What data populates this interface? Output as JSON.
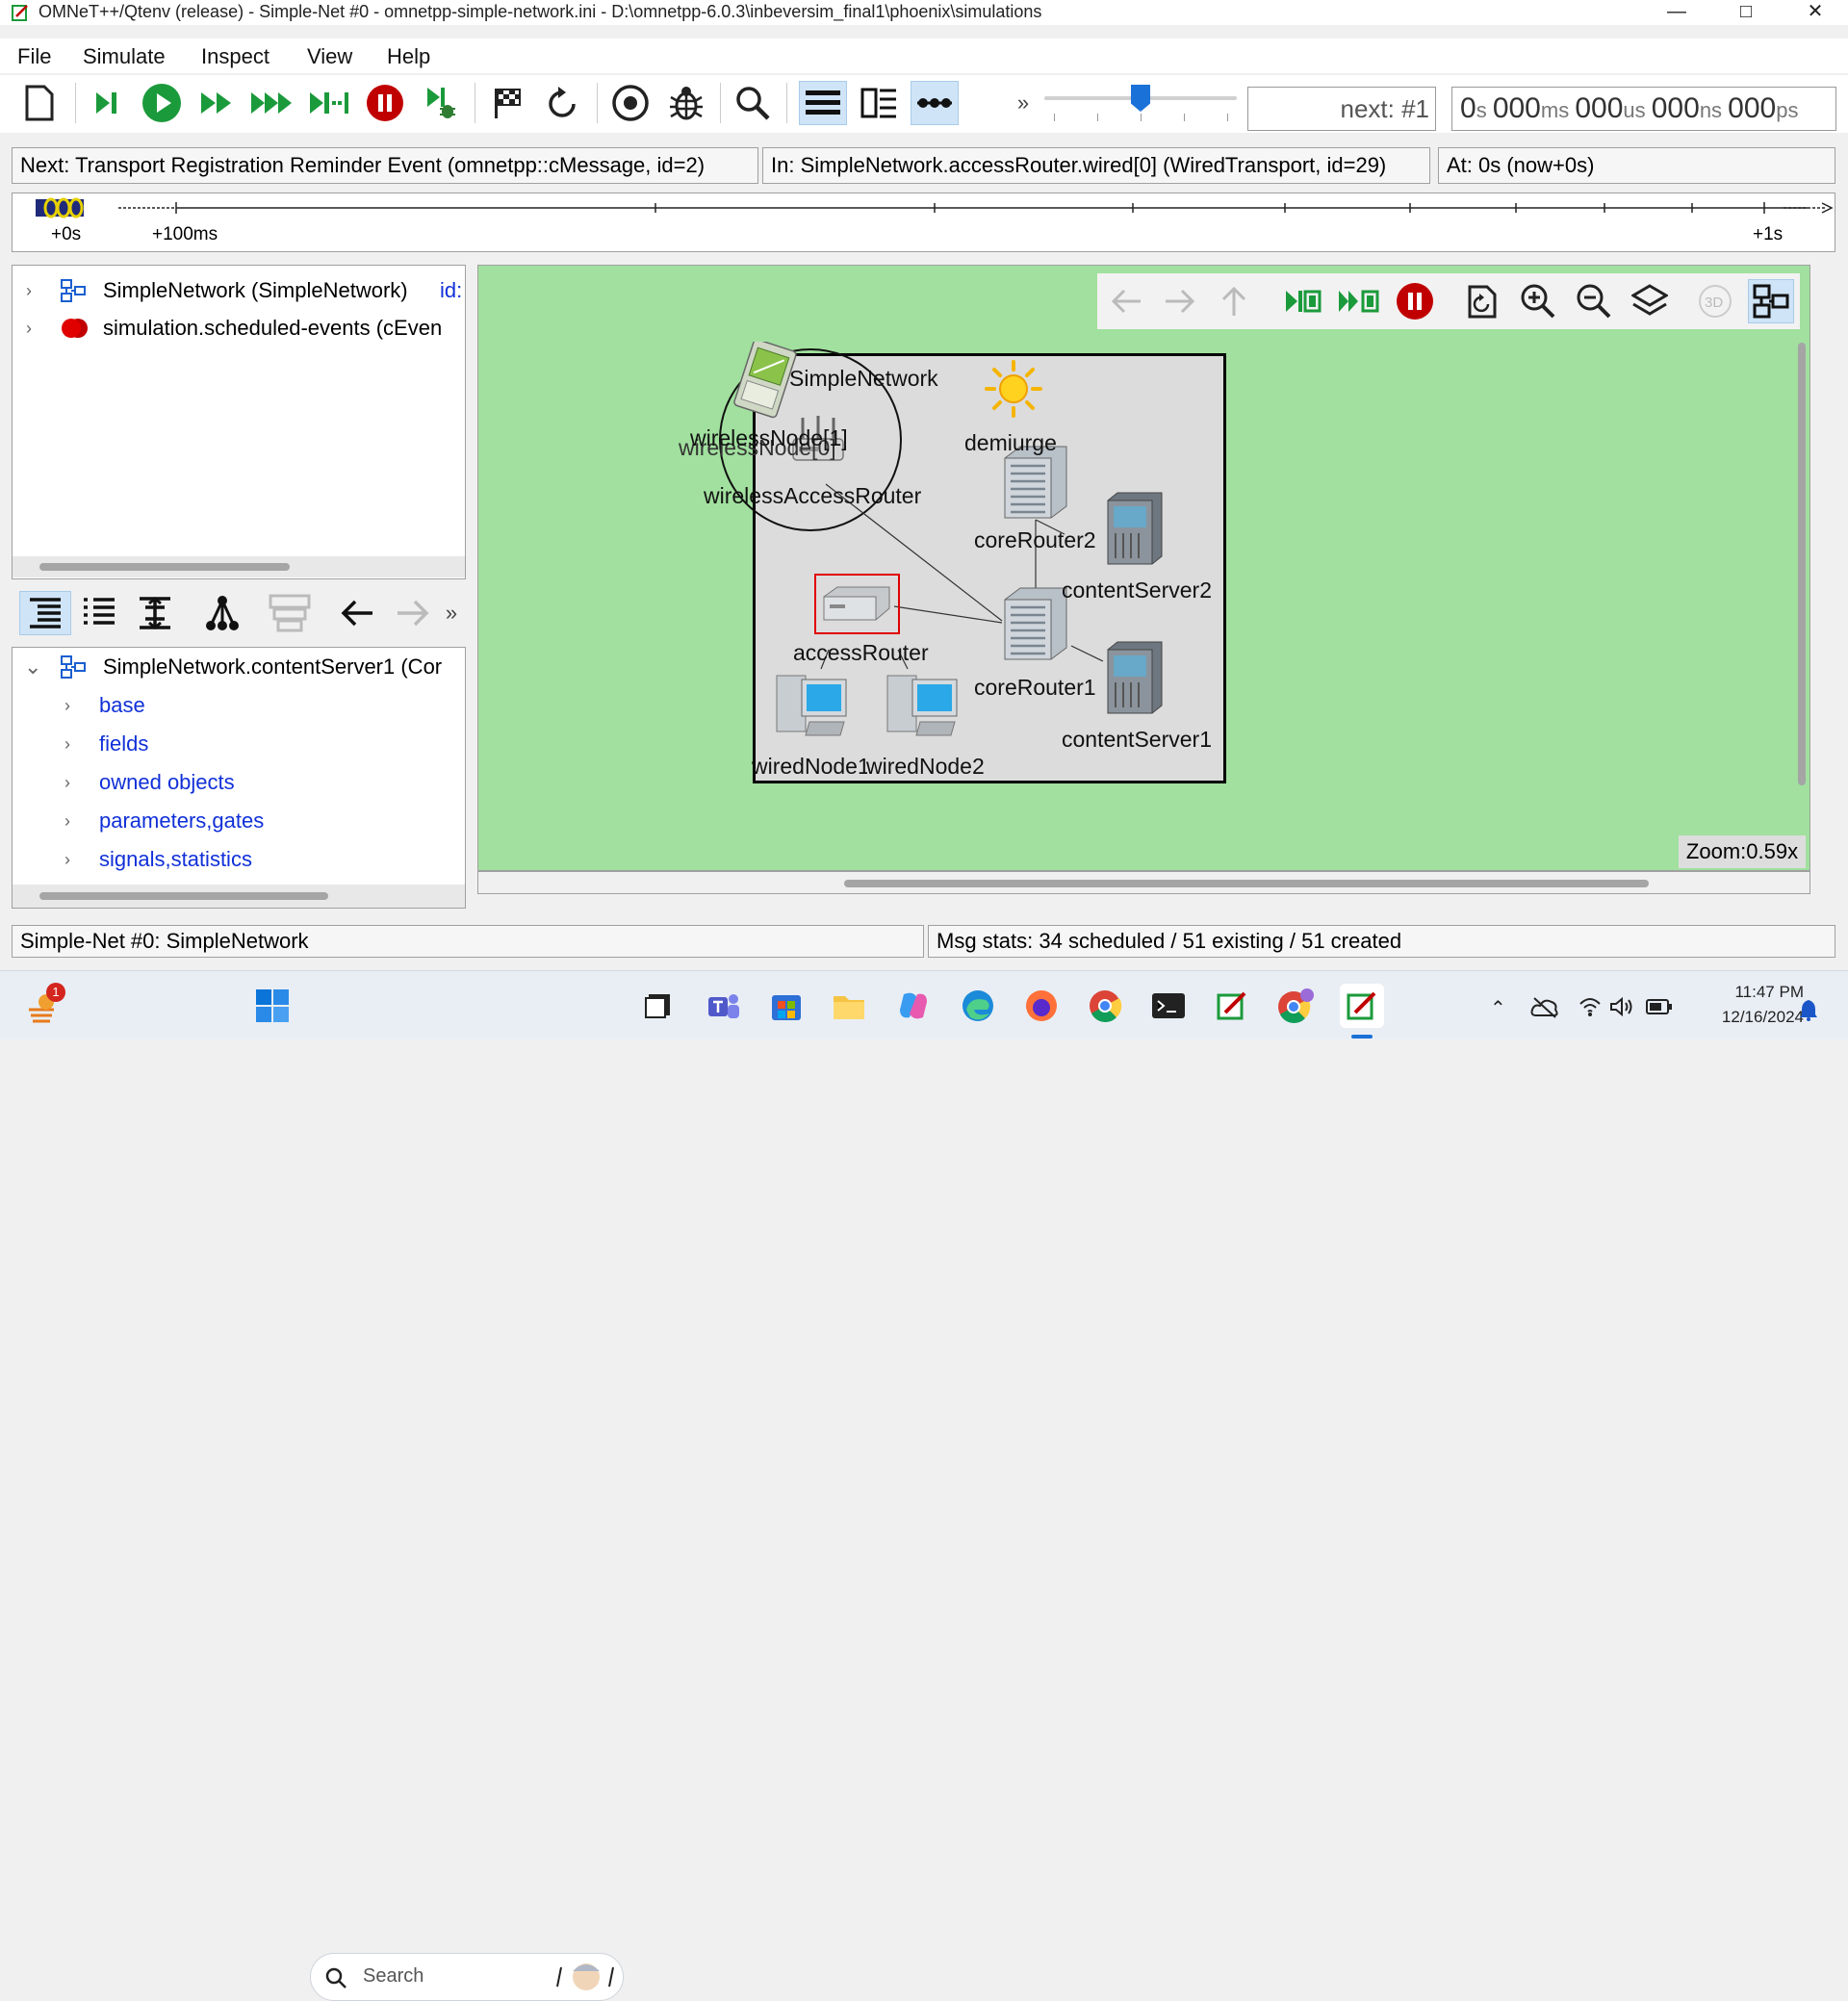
{
  "window": {
    "title": "OMNeT++/Qtenv (release) - Simple-Net #0 - omnetpp-simple-network.ini - D:\\omnetpp-6.0.3\\inbeversim_final1\\phoenix\\simulations",
    "controls": [
      "minimize",
      "maximize",
      "close"
    ]
  },
  "menu": [
    "File",
    "Simulate",
    "Inspect",
    "View",
    "Help"
  ],
  "toolbar": {
    "buttons": [
      "new-file-icon",
      "step-icon",
      "run-icon",
      "fast-run-icon",
      "express-run-icon",
      "run-until-icon",
      "stop-icon",
      "debug-next-icon",
      "finish-icon",
      "rebuild-icon",
      "record-icon",
      "debug-icon",
      "find-icon",
      "timeline-toggle-icon",
      "split-view-icon",
      "animation-icon"
    ],
    "overflow": "»",
    "next_event": "next: #1",
    "sim_time": {
      "s": "0",
      "ms": "000",
      "us": "000",
      "ns": "000",
      "ps": "000"
    }
  },
  "info": {
    "next": "Next: Transport Registration Reminder Event (omnetpp::cMessage, id=2)",
    "in": "In: SimpleNetwork.accessRouter.wired[0] (WiredTransport, id=29)",
    "at": "At: 0s (now+0s)"
  },
  "timeline": {
    "labels": [
      "+0s",
      "+100ms",
      "+1s"
    ]
  },
  "object_tree": {
    "items": [
      {
        "label": "SimpleNetwork (SimpleNetwork)",
        "suffix": "id:"
      },
      {
        "label": "simulation.scheduled-events (cEven"
      }
    ]
  },
  "inspector_toolbar": {
    "overflow": "»"
  },
  "inspector": {
    "root": "SimpleNetwork.contentServer1 (Cor",
    "children": [
      "base",
      "fields",
      "owned objects",
      "parameters,gates",
      "signals,statistics"
    ]
  },
  "network": {
    "title": "SimpleNetwork",
    "nodes": {
      "wirelessNode1": "wirelessNode[1]",
      "wirelessNode0": "wirelessNode[0]",
      "wirelessAccessRouter": "wirelessAccessRouter",
      "demiurge": "demiurge",
      "coreRouter2": "coreRouter2",
      "contentServer2": "contentServer2",
      "accessRouter": "accessRouter",
      "coreRouter1": "coreRouter1",
      "wiredNode1": "wiredNode1",
      "wiredNode2": "wiredNode2",
      "contentServer1": "contentServer1"
    }
  },
  "zoom": "Zoom:0.59x",
  "status": {
    "left": "Simple-Net #0: SimpleNetwork",
    "right": "Msg stats: 34 scheduled / 51 existing / 51 created"
  },
  "taskbar": {
    "search_placeholder": "Search",
    "time": "11:47 PM",
    "date": "12/16/2024",
    "notification_badge": "1"
  },
  "colors": {
    "canvas": "#a1e09e",
    "network_bg": "#dcdcdc",
    "stop": "#c00000",
    "run": "#1b9a3b",
    "link_blue": "#1030d8"
  }
}
